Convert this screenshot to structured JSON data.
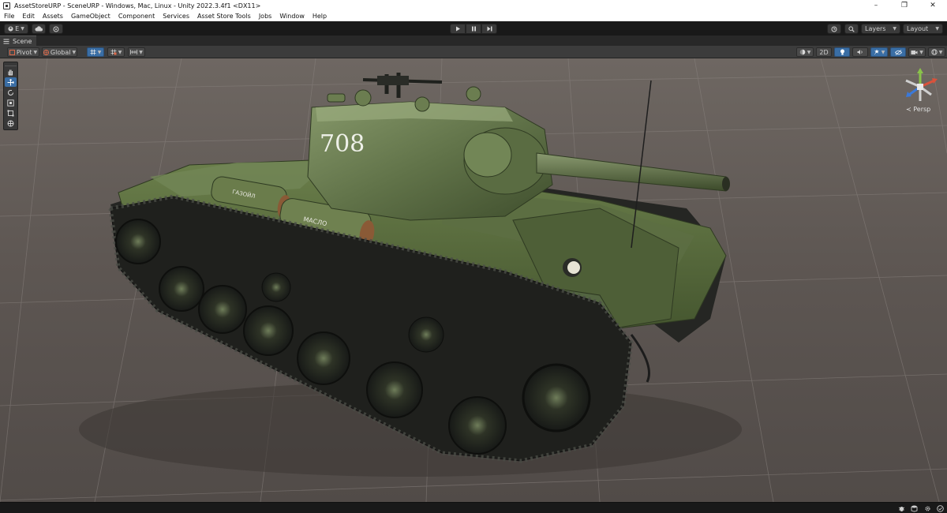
{
  "window": {
    "title": "AssetStoreURP - SceneURP - Windows, Mac, Linux - Unity 2022.3.4f1 <DX11>",
    "controls": [
      "minimize",
      "restore",
      "close"
    ]
  },
  "menu": {
    "items": [
      "File",
      "Edit",
      "Assets",
      "GameObject",
      "Component",
      "Services",
      "Asset Store Tools",
      "Jobs",
      "Window",
      "Help"
    ]
  },
  "toolbar": {
    "account_label": "E",
    "layers_label": "Layers",
    "layout_label": "Layout"
  },
  "scene_tab": {
    "label": "Scene"
  },
  "scene_toolbar": {
    "pivot_label": "Pivot",
    "global_label": "Global",
    "mode_2d_label": "2D"
  },
  "tank": {
    "turret_number": "708",
    "barrel_label_1": "ГАЗОЙЛ",
    "barrel_label_2": "МАСЛО"
  },
  "gizmo": {
    "projection_label": "Persp"
  },
  "colors": {
    "accent_blue": "#3a6ea5",
    "tank_green": "#55683e",
    "ground": "#605854"
  },
  "icons": {
    "tools": [
      "hand-icon",
      "move-icon",
      "rotate-icon",
      "scale-icon",
      "rect-icon",
      "transform-icon"
    ],
    "status": [
      "bug-icon",
      "cache-icon",
      "gear-icon",
      "check-icon"
    ]
  }
}
